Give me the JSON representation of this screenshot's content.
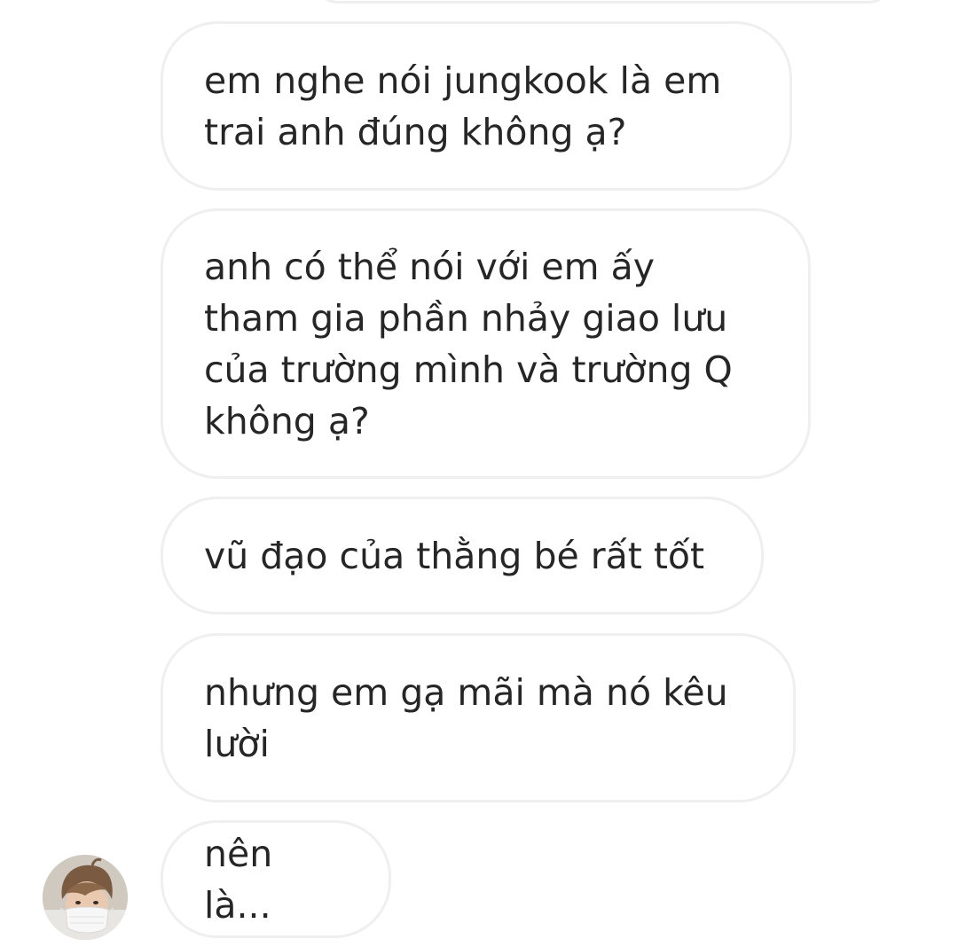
{
  "thread": {
    "messages": [
      {
        "text": "em nghe nói jungkook là em\ntrai anh đúng không ạ?"
      },
      {
        "text": "anh có thể nói với em ấy\ntham gia phần nhảy giao lưu\ncủa trường mình và trường Q\nkhông ạ?"
      },
      {
        "text": "vũ đạo của thằng bé rất tốt"
      },
      {
        "text": "nhưng em gạ mãi mà nó kêu\nlười"
      },
      {
        "text": "nên là..."
      }
    ]
  },
  "colors": {
    "bubble_border": "#efefef",
    "text": "#262626",
    "background": "#ffffff"
  },
  "icons": {
    "avatar": "user-avatar-photo"
  }
}
